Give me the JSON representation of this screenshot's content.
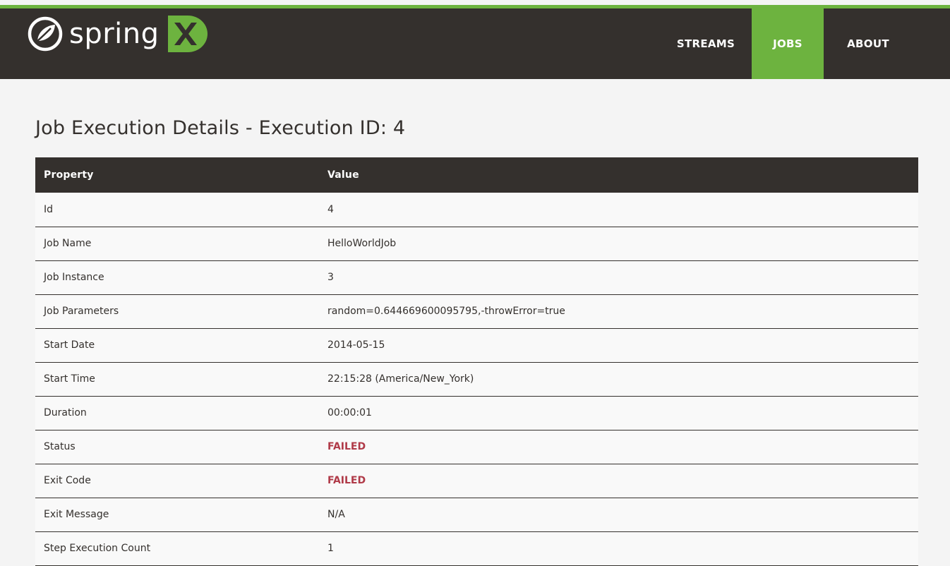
{
  "brand": {
    "name": "spring",
    "accent_color": "#6db33f",
    "header_bg": "#34302d",
    "logo_icon": "spring-leaf-icon",
    "x_icon": "spring-xd-x-icon"
  },
  "nav": {
    "items": [
      {
        "label": "STREAMS",
        "active": false
      },
      {
        "label": "JOBS",
        "active": true
      },
      {
        "label": "ABOUT",
        "active": false
      }
    ]
  },
  "page": {
    "title": "Job Execution Details - Execution ID: 4"
  },
  "table": {
    "headers": [
      "Property",
      "Value"
    ],
    "rows": [
      {
        "property": "Id",
        "value": "4"
      },
      {
        "property": "Job Name",
        "value": "HelloWorldJob"
      },
      {
        "property": "Job Instance",
        "value": "3"
      },
      {
        "property": "Job Parameters",
        "value": "random=0.644669600095795,-throwError=true"
      },
      {
        "property": "Start Date",
        "value": "2014-05-15"
      },
      {
        "property": "Start Time",
        "value": "22:15:28 (America/New_York)"
      },
      {
        "property": "Duration",
        "value": "00:00:01"
      },
      {
        "property": "Status",
        "value": "FAILED"
      },
      {
        "property": "Exit Code",
        "value": "FAILED"
      },
      {
        "property": "Exit Message",
        "value": "N/A"
      },
      {
        "property": "Step Execution Count",
        "value": "1"
      }
    ],
    "failed_color": "#b03a48"
  }
}
